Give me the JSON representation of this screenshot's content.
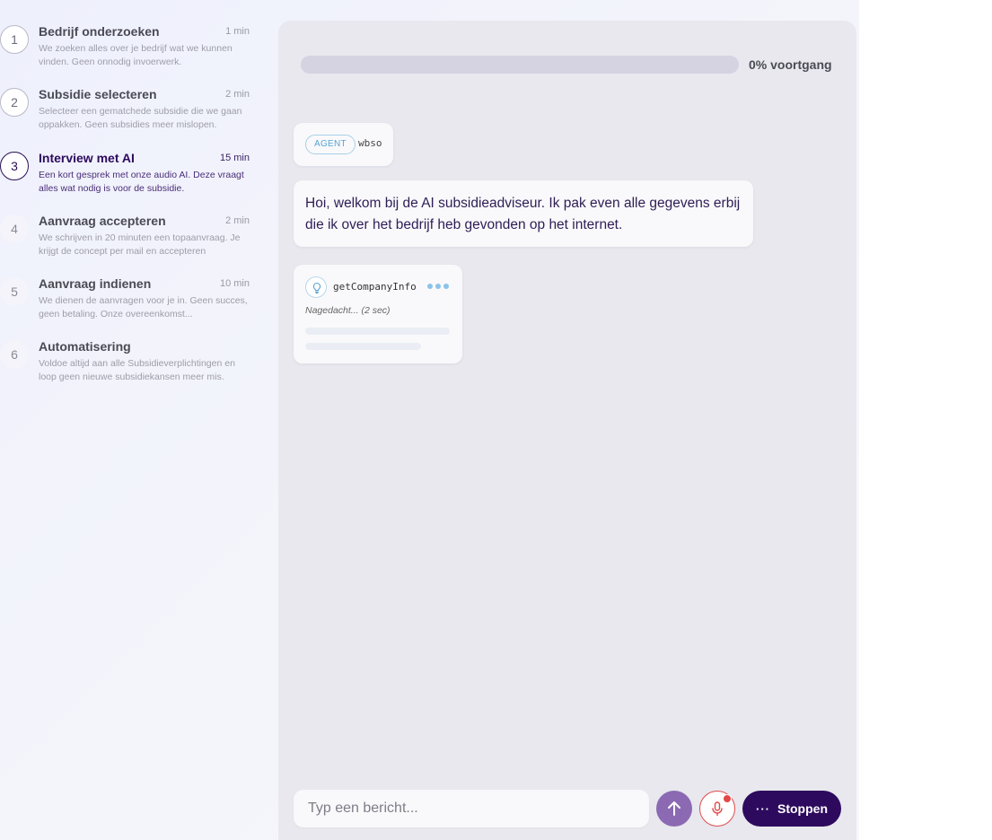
{
  "steps": [
    {
      "number": "1",
      "title": "Bedrijf onderzoeken",
      "time": "1 min",
      "description": "We zoeken alles over je bedrijf wat we kunnen vinden. Geen onnodig invoerwerk."
    },
    {
      "number": "2",
      "title": "Subsidie selecteren",
      "time": "2 min",
      "description": "Selecteer een gematchede subsidie die we gaan oppakken. Geen subsidies meer mislopen."
    },
    {
      "number": "3",
      "title": "Interview met AI",
      "time": "15 min",
      "description": "Een kort gesprek met onze audio AI. Deze vraagt alles wat nodig is voor de subsidie."
    },
    {
      "number": "4",
      "title": "Aanvraag accepteren",
      "time": "2 min",
      "description": "We schrijven in 20 minuten een topaanvraag. Je krijgt de concept per mail en accepteren"
    },
    {
      "number": "5",
      "title": "Aanvraag indienen",
      "time": "10 min",
      "description": "We dienen de aanvragen voor je in. Geen succes, geen betaling. Onze overeenkomst..."
    },
    {
      "number": "6",
      "title": "Automatisering",
      "time": "",
      "description": "Voldoe altijd aan alle Subsidieverplichtingen en loop geen nieuwe subsidiekansen meer mis."
    }
  ],
  "active_step": 3,
  "progress": {
    "value": 0,
    "label": "0% voortgang"
  },
  "chat": {
    "agent_tag": "AGENT",
    "agent_name": "wbso",
    "message": "Hoi, welkom bij de AI subsidieadviseur. Ik pak even alle gegevens erbij die ik over het bedrijf heb gevonden op het internet.",
    "tool": {
      "name": "getCompanyInfo",
      "status": "Nagedacht... (2 sec)",
      "icon": "lightbulb-icon"
    }
  },
  "composer": {
    "placeholder": "Typ een bericht...",
    "stop_label": "Stoppen",
    "stop_dots": "···"
  },
  "colors": {
    "brand_dark": "#2d0a5e",
    "send_button": "#8b6ab3",
    "record_red": "#e34848",
    "accent_blue": "#8cc3ea"
  }
}
